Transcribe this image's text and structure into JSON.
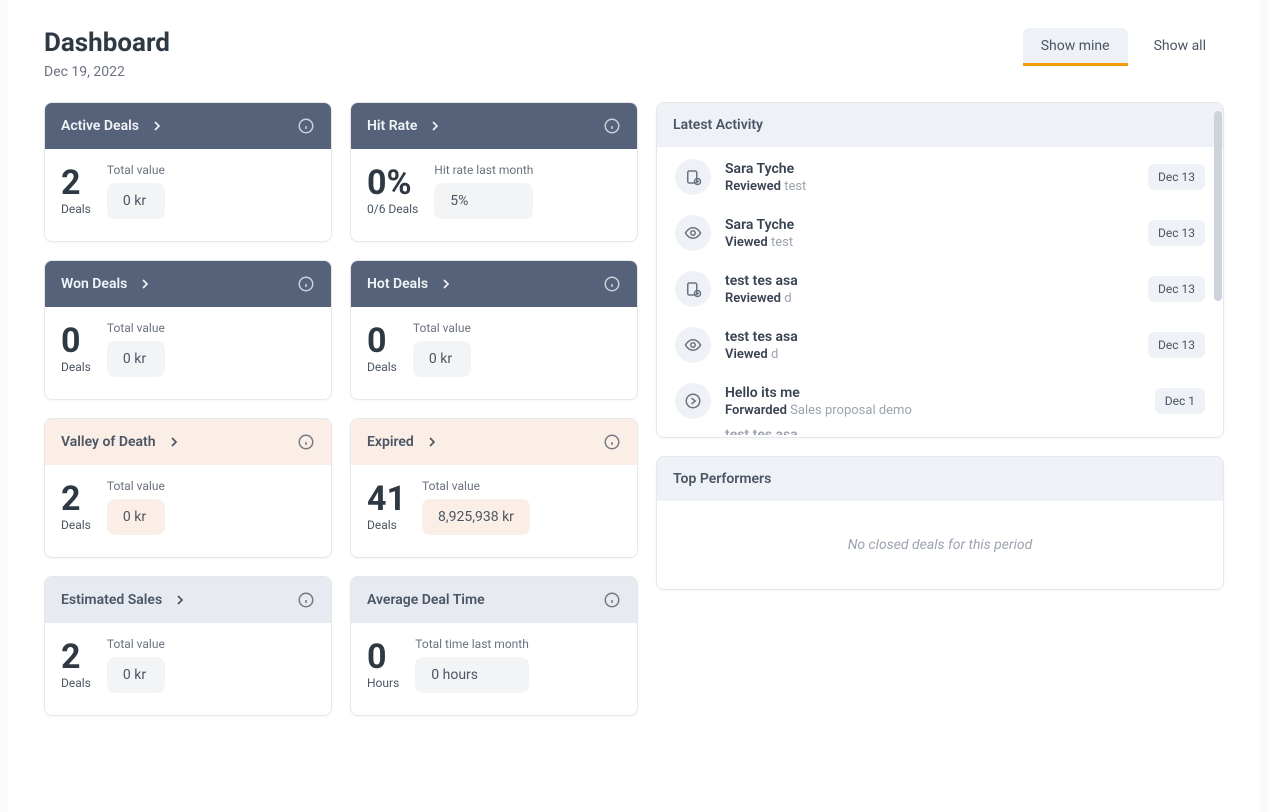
{
  "header": {
    "title": "Dashboard",
    "date": "Dec 19, 2022",
    "tabs": {
      "mine": "Show mine",
      "all": "Show all"
    }
  },
  "cards": {
    "active_deals": {
      "title": "Active Deals",
      "count": "2",
      "unit": "Deals",
      "value_label": "Total value",
      "value": "0 kr"
    },
    "hit_rate": {
      "title": "Hit Rate",
      "percent": "0%",
      "detail": "0/6 Deals",
      "value_label": "Hit rate last month",
      "value": "5%"
    },
    "won_deals": {
      "title": "Won Deals",
      "count": "0",
      "unit": "Deals",
      "value_label": "Total value",
      "value": "0 kr"
    },
    "hot_deals": {
      "title": "Hot Deals",
      "count": "0",
      "unit": "Deals",
      "value_label": "Total value",
      "value": "0 kr"
    },
    "valley_of_death": {
      "title": "Valley of Death",
      "count": "2",
      "unit": "Deals",
      "value_label": "Total value",
      "value": "0 kr"
    },
    "expired": {
      "title": "Expired",
      "count": "41",
      "unit": "Deals",
      "value_label": "Total value",
      "value": "8,925,938 kr"
    },
    "estimated_sales": {
      "title": "Estimated Sales",
      "count": "2",
      "unit": "Deals",
      "value_label": "Total value",
      "value": "0 kr"
    },
    "avg_deal_time": {
      "title": "Average Deal Time",
      "count": "0",
      "unit": "Hours",
      "value_label": "Total time last month",
      "value": "0 hours"
    }
  },
  "latest_activity": {
    "title": "Latest Activity",
    "items": [
      {
        "name": "Sara Tyche",
        "verb": "Reviewed",
        "obj": "test",
        "date": "Dec 13",
        "icon": "reviewed"
      },
      {
        "name": "Sara Tyche",
        "verb": "Viewed",
        "obj": "test",
        "date": "Dec 13",
        "icon": "viewed"
      },
      {
        "name": "test tes asa",
        "verb": "Reviewed",
        "obj": "d",
        "date": "Dec 13",
        "icon": "reviewed"
      },
      {
        "name": "test tes asa",
        "verb": "Viewed",
        "obj": "d",
        "date": "Dec 13",
        "icon": "viewed"
      },
      {
        "name": "Hello its me",
        "verb": "Forwarded",
        "obj": "Sales proposal demo",
        "date": "Dec 1",
        "icon": "forwarded"
      }
    ],
    "cut": "test tes asa"
  },
  "top_performers": {
    "title": "Top Performers",
    "empty": "No closed deals for this period"
  }
}
